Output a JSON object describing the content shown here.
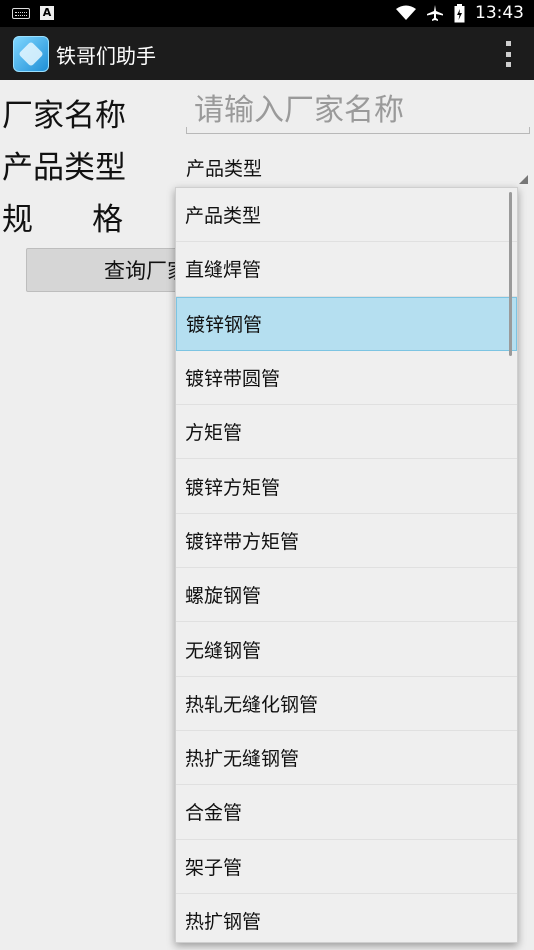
{
  "status_bar": {
    "time": "13:43",
    "notification_a": "A"
  },
  "action_bar": {
    "title": "铁哥们助手"
  },
  "form": {
    "manufacturer_label": "厂家名称",
    "manufacturer_placeholder": "请输入厂家名称",
    "manufacturer_value": "",
    "product_type_label": "产品类型",
    "product_type_selected": "产品类型",
    "spec_label": "规      格",
    "query_button": "查询厂家"
  },
  "dropdown": {
    "selected_index": 2,
    "items": [
      "产品类型",
      "直缝焊管",
      "镀锌钢管",
      "镀锌带圆管",
      "方矩管",
      "镀锌方矩管",
      "镀锌带方矩管",
      "螺旋钢管",
      "无缝钢管",
      "热轧无缝化钢管",
      "热扩无缝钢管",
      "合金管",
      "架子管",
      "热扩钢管"
    ]
  },
  "colors": {
    "selected_item_bg": "#b5dff0",
    "action_bar_bg": "#1c1c1c"
  }
}
